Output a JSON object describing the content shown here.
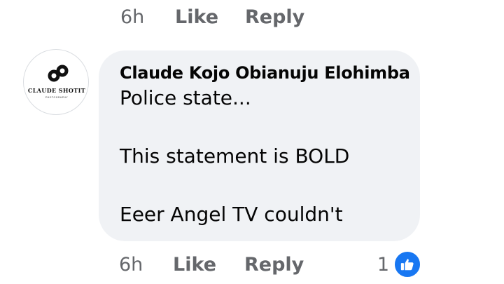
{
  "previous_comment_actions": {
    "time": "6h",
    "like_label": "Like",
    "reply_label": "Reply"
  },
  "comment": {
    "avatar": {
      "icon": "brand-logo-icon",
      "brand_name": "CLAUDE SHOTIT",
      "brand_sub": "PHOTOGRAPHY"
    },
    "author": "Claude Kojo Obianuju Elohimba",
    "text_lines": [
      "Police state...",
      "",
      "This statement is BOLD",
      "",
      "Eeer Angel TV couldn't"
    ],
    "bubble_color": "#f0f2f5",
    "actions": {
      "time": "6h",
      "like_label": "Like",
      "reply_label": "Reply",
      "reaction_count": "1",
      "reaction_icon": "thumbs-up-icon",
      "reaction_color": "#1877f2"
    }
  }
}
